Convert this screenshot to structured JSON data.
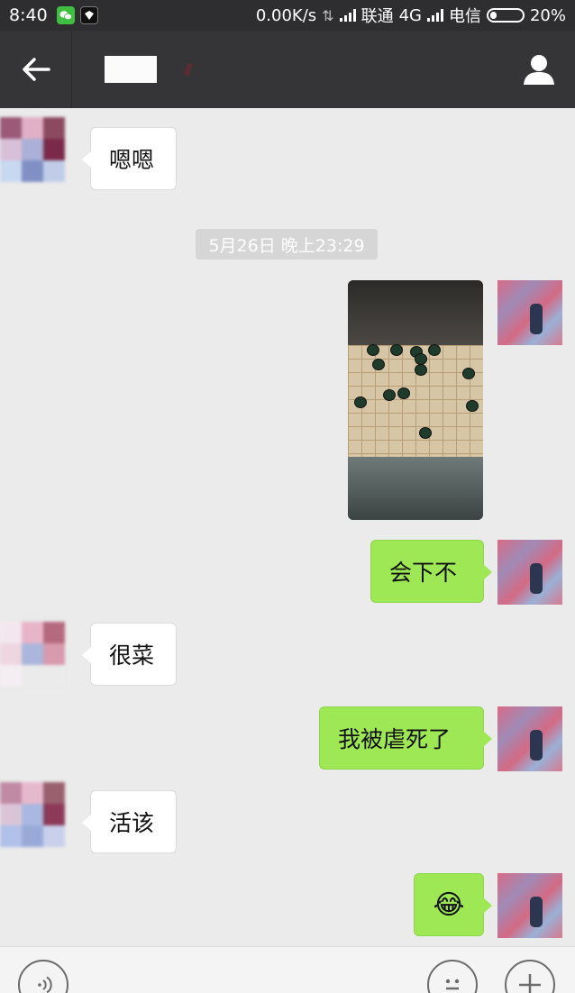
{
  "status_bar": {
    "time": "8:40",
    "net_speed": "0.00K/s",
    "carrier1": "联通",
    "network_type": "4G",
    "carrier2": "电信",
    "battery": "20%"
  },
  "header": {
    "back_icon": "arrow-left-icon",
    "profile_icon": "person-icon"
  },
  "messages": [
    {
      "side": "in",
      "text": "嗯嗯"
    },
    {
      "side": "out",
      "type": "image"
    },
    {
      "side": "out",
      "text": "会下不"
    },
    {
      "side": "in",
      "text": "很菜"
    },
    {
      "side": "out",
      "text": "我被虐死了"
    },
    {
      "side": "in",
      "text": "活该"
    },
    {
      "side": "out",
      "text": "😂",
      "icon": "laughing-crying-emoji-icon"
    }
  ],
  "timestamp": "5月26日 晚上23:29",
  "input_bar": {
    "voice_icon": "voice-icon",
    "emoji_icon": "emoji-face-icon",
    "plus_icon": "plus-icon"
  },
  "colors": {
    "header_bg": "#353538",
    "status_bg": "#2e2e30",
    "chat_bg": "#ebebeb",
    "out_bubble": "#9ee856",
    "in_bubble": "#ffffff"
  }
}
